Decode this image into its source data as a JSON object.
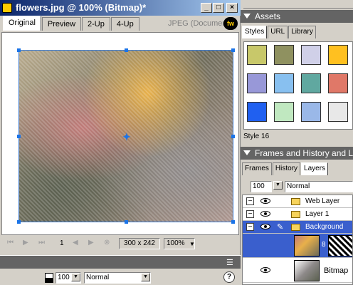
{
  "document": {
    "title": "flowers.jpg @ 100% (Bitmap)*",
    "window_buttons": [
      "_",
      "□",
      "×"
    ],
    "tabs": [
      {
        "label": "Original",
        "active": true
      },
      {
        "label": "Preview",
        "active": false
      },
      {
        "label": "2-Up",
        "active": false
      },
      {
        "label": "4-Up",
        "active": false
      }
    ],
    "format_label": "JPEG (Document)",
    "logo_text": "fw",
    "status": {
      "frame": "1",
      "size": "300 x 242",
      "zoom": "100%"
    }
  },
  "assets_panel": {
    "title": "Assets",
    "tabs": [
      {
        "label": "Styles",
        "active": true
      },
      {
        "label": "URL",
        "active": false
      },
      {
        "label": "Library",
        "active": false
      }
    ],
    "swatch_colors": [
      "#c8c86a",
      "#8f9160",
      "#d0d0e8",
      "#ffc020",
      "#ffd000",
      "#9898d8",
      "#88c0f0",
      "#60a8a0",
      "#e07868",
      "#ff8080",
      "#2060f0",
      "#c0e8c0",
      "#9ab8e8",
      "#e8e8e8",
      "#e03020"
    ],
    "selected_style": "Style 16"
  },
  "layers_panel": {
    "title": "Frames and History and La",
    "tabs": [
      {
        "label": "Frames",
        "active": false
      },
      {
        "label": "History",
        "active": false
      },
      {
        "label": "Layers",
        "active": true
      }
    ],
    "opacity": "100",
    "blend_mode": "Normal",
    "layers": [
      {
        "name": "Web Layer",
        "type": "folder",
        "selected": false
      },
      {
        "name": "Layer 1",
        "type": "folder",
        "selected": false
      },
      {
        "name": "Background",
        "type": "folder",
        "selected": true
      }
    ],
    "objects": [
      {
        "name": "",
        "selected": true
      },
      {
        "name": "Bitmap",
        "selected": false
      }
    ]
  },
  "properties_bar": {
    "opacity": "100",
    "blend_mode": "Normal",
    "help": "?"
  }
}
